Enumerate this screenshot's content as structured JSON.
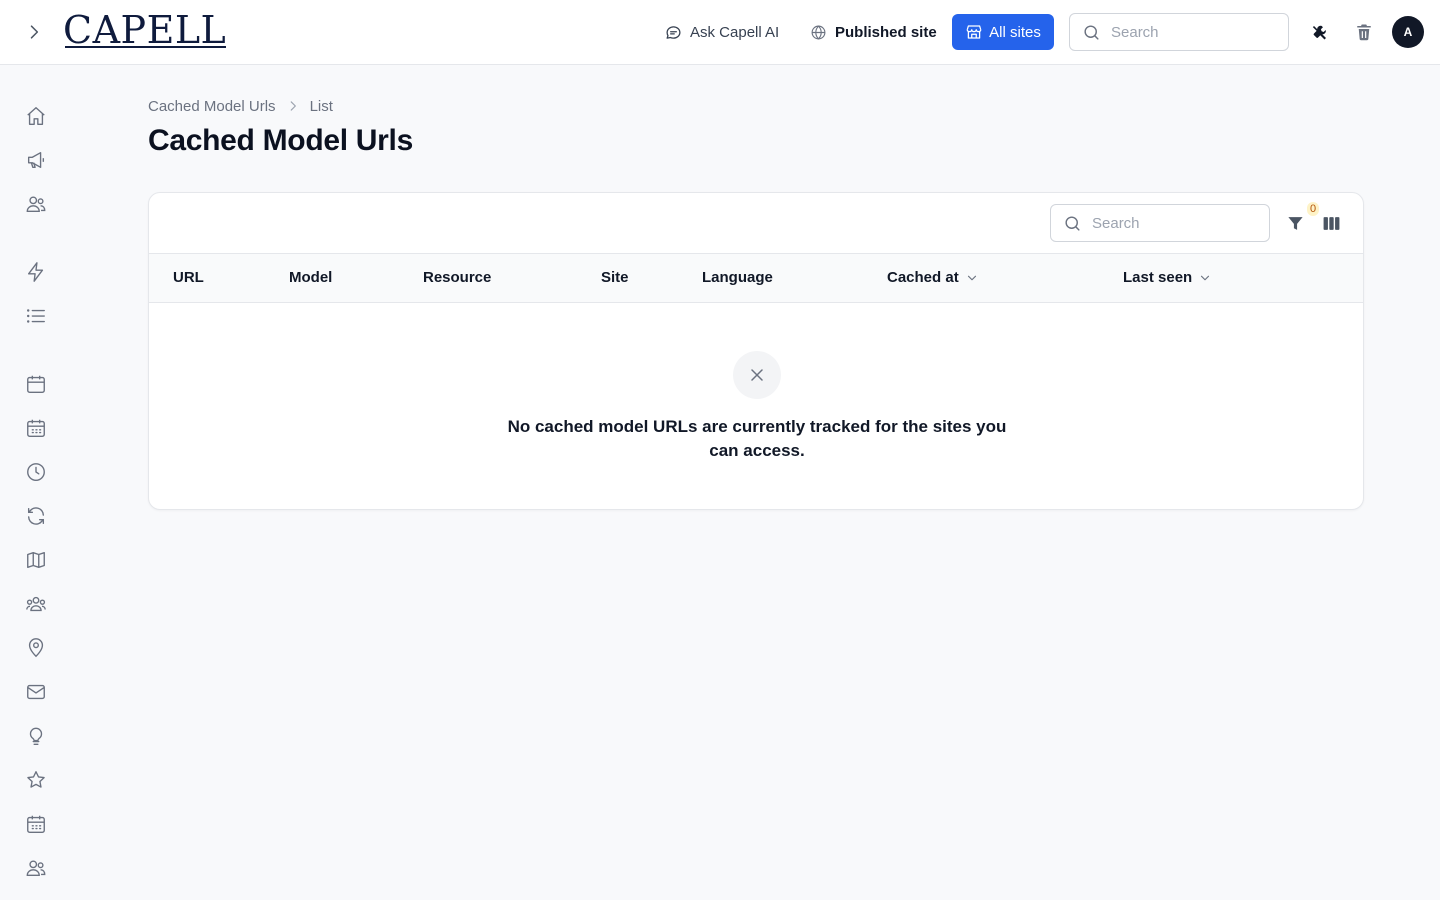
{
  "header": {
    "logo_text": "CAPELL",
    "ask_ai_label": "Ask Capell AI",
    "published_site_label": "Published site",
    "all_sites_label": "All sites",
    "search_placeholder": "Search",
    "avatar_initial": "A",
    "accent_color": "#2563eb"
  },
  "sidebar": {
    "icons": [
      "home-icon",
      "megaphone-icon",
      "users-icon",
      "bolt-icon",
      "list-icon",
      "calendar-icon",
      "calendar-days-icon",
      "clock-icon",
      "refresh-icon",
      "map-icon",
      "user-group-icon",
      "map-pin-icon",
      "envelope-icon",
      "light-bulb-icon",
      "star-icon",
      "calendar-days-icon",
      "users-icon"
    ]
  },
  "breadcrumb": {
    "parent": "Cached Model Urls",
    "current": "List"
  },
  "page": {
    "title": "Cached Model Urls"
  },
  "table": {
    "search_placeholder": "Search",
    "filter_count": "0",
    "columns": [
      "URL",
      "Model",
      "Resource",
      "Site",
      "Language",
      "Cached at",
      "Last seen"
    ],
    "empty_message": "No cached model URLs are currently tracked for the sites you can access."
  }
}
